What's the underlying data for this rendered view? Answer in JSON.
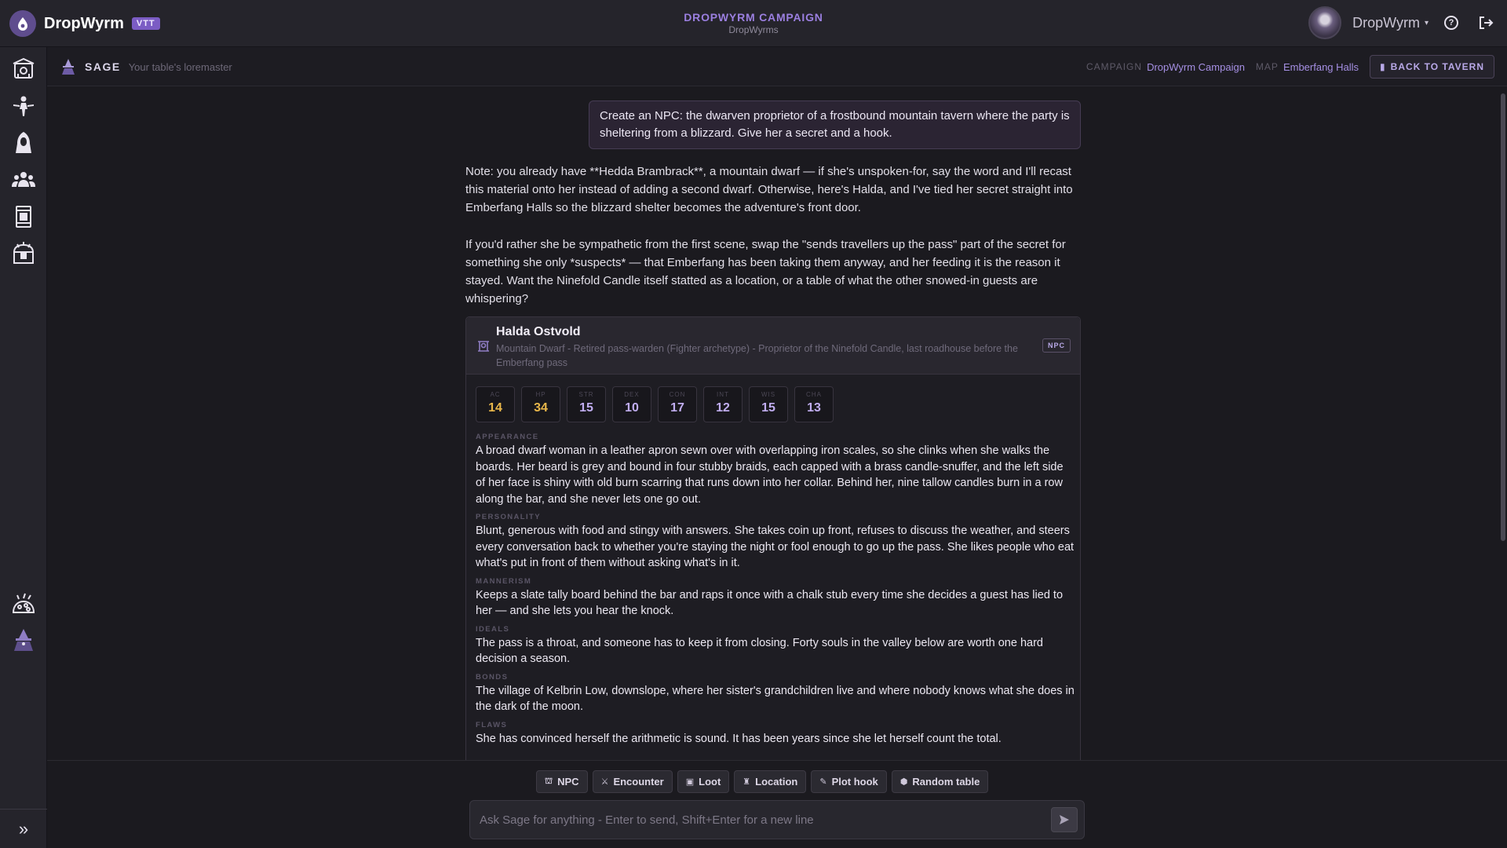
{
  "header": {
    "brand": "DropWyrm",
    "badge": "VTT",
    "campaign_title": "DROPWYRM CAMPAIGN",
    "campaign_sub": "DropWyrms",
    "user_name": "DropWyrm"
  },
  "rail": {
    "items": [
      "tavern-icon",
      "fighter-icon",
      "hooded-figure-icon",
      "party-icon",
      "banner-icon",
      "treasure-icon",
      "loot-pile-icon",
      "wizard-icon"
    ],
    "expand": "»"
  },
  "sage": {
    "name": "SAGE",
    "tagline": "Your table's loremaster",
    "campaign_key": "CAMPAIGN",
    "campaign_val": "DropWyrm Campaign",
    "map_key": "MAP",
    "map_val": "Emberfang Halls",
    "back_label": "BACK TO TAVERN"
  },
  "chat": {
    "user_message": "Create an NPC: the dwarven proprietor of a frostbound mountain tavern where the party is sheltering from a blizzard. Give her a secret and a hook.",
    "reply_p1": "Note: you already have **Hedda Brambrack**, a mountain dwarf — if she's unspoken-for, say the word and I'll recast this material onto her instead of adding a second dwarf. Otherwise, here's Halda, and I've tied her secret straight into Emberfang Halls so the blizzard shelter becomes the adventure's front door.",
    "reply_p2": "If you'd rather she be sympathetic from the first scene, swap the \"sends travellers up the pass\" part of the secret for something she only *suspects* — that Emberfang has been taking them anyway, and her feeding it is the reason it stayed. Want the Ninefold Candle itself statted as a location, or a table of what the other snowed-in guests are whispering?"
  },
  "npc": {
    "name": "Halda Ostvold",
    "description": "Mountain Dwarf - Retired pass-warden (Fighter archetype) - Proprietor of the Ninefold Candle, last roadhouse before the Emberfang pass",
    "badge": "NPC",
    "stats": [
      {
        "label": "AC",
        "value": "14"
      },
      {
        "label": "HP",
        "value": "34"
      },
      {
        "label": "STR",
        "value": "15"
      },
      {
        "label": "DEX",
        "value": "10"
      },
      {
        "label": "CON",
        "value": "17"
      },
      {
        "label": "INT",
        "value": "12"
      },
      {
        "label": "WIS",
        "value": "15"
      },
      {
        "label": "CHA",
        "value": "13"
      }
    ],
    "sections": [
      {
        "label": "APPEARANCE",
        "text": "A broad dwarf woman in a leather apron sewn over with overlapping iron scales, so she clinks when she walks the boards. Her beard is grey and bound in four stubby braids, each capped with a brass candle-snuffer, and the left side of her face is shiny with old burn scarring that runs down into her collar. Behind her, nine tallow candles burn in a row along the bar, and she never lets one go out."
      },
      {
        "label": "PERSONALITY",
        "text": "Blunt, generous with food and stingy with answers. She takes coin up front, refuses to discuss the weather, and steers every conversation back to whether you're staying the night or fool enough to go up the pass. She likes people who eat what's put in front of them without asking what's in it."
      },
      {
        "label": "MANNERISM",
        "text": "Keeps a slate tally board behind the bar and raps it once with a chalk stub every time she decides a guest has lied to her — and she lets you hear the knock."
      },
      {
        "label": "IDEALS",
        "text": "The pass is a throat, and someone has to keep it from closing. Forty souls in the valley below are worth one hard decision a season."
      },
      {
        "label": "BONDS",
        "text": "The village of Kelbrin Low, downslope, where her sister's grandchildren live and where nobody knows what she does in the dark of the moon."
      },
      {
        "label": "FLAWS",
        "text": "She has convinced herself the arithmetic is sound. It has been years since she let herself count the total."
      }
    ]
  },
  "composer": {
    "chips": [
      "NPC",
      "Encounter",
      "Loot",
      "Location",
      "Plot hook",
      "Random table"
    ],
    "placeholder": "Ask Sage for anything - Enter to send, Shift+Enter for a new line"
  },
  "colors": {
    "accent": "#9b7fe0",
    "gold": "#e9b74a",
    "background": "#1b1a1f"
  }
}
